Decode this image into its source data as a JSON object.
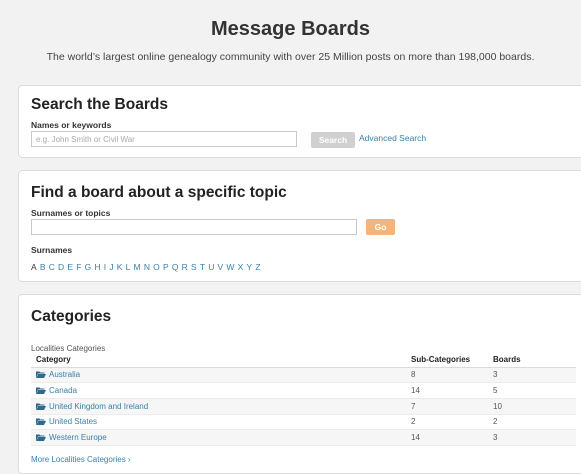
{
  "header": {
    "title": "Message Boards",
    "subtitle": "The world’s largest online genealogy community with over 25 Million posts on more than 198,000 boards."
  },
  "search": {
    "title": "Search the Boards",
    "label": "Names or keywords",
    "placeholder": "e.g. John Smith or Civil War",
    "value": "",
    "button_label": "Search",
    "advanced_link": "Advanced Search"
  },
  "topic": {
    "title": "Find a board about a specific topic",
    "label": "Surnames or topics",
    "value": "",
    "button_label": "Go",
    "surnames_label": "Surnames",
    "letters": [
      "A",
      "B",
      "C",
      "D",
      "E",
      "F",
      "G",
      "H",
      "I",
      "J",
      "K",
      "L",
      "M",
      "N",
      "O",
      "P",
      "Q",
      "R",
      "S",
      "T",
      "U",
      "V",
      "W",
      "X",
      "Y",
      "Z"
    ]
  },
  "categories": {
    "title": "Categories",
    "subtitle": "Localities Categories",
    "columns": [
      "Category",
      "Sub-Categories",
      "Boards"
    ],
    "rows": [
      {
        "name": "Australia",
        "sub": "8",
        "boards": "3"
      },
      {
        "name": "Canada",
        "sub": "14",
        "boards": "5"
      },
      {
        "name": "United Kingdom and Ireland",
        "sub": "7",
        "boards": "10"
      },
      {
        "name": "United States",
        "sub": "2",
        "boards": "2"
      },
      {
        "name": "Western Europe",
        "sub": "14",
        "boards": "3"
      }
    ],
    "more_link": "More Localities Categories ›",
    "icon": "folder-icon"
  },
  "colors": {
    "link": "#3a7fa8",
    "go_button": "#f5b47c",
    "search_button": "#d0d0d0",
    "folder_icon": "#2e6a8c"
  }
}
